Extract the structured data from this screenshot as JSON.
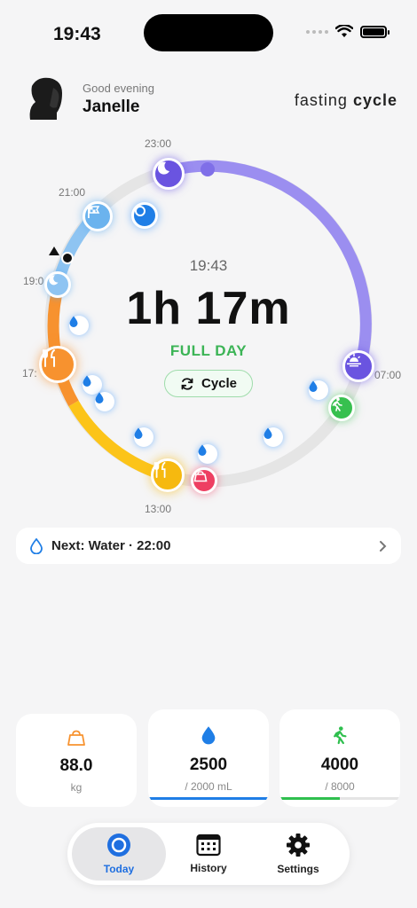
{
  "status_bar": {
    "time": "19:43"
  },
  "header": {
    "greeting": "Good evening",
    "name": "Janelle",
    "logo_prefix": "fasting",
    "logo_suffix": "cycle"
  },
  "dial": {
    "current_time": "19:43",
    "elapsed": "1h 17m",
    "phase": "FULL DAY",
    "cycle_button": "Cycle",
    "hour_labels": {
      "h23": "23:00",
      "h21": "21:00",
      "h19": "19:0",
      "h17": "17:",
      "h13": "13:00",
      "h07": "07:00"
    },
    "colors": {
      "night": "#9b8ef0",
      "evening": "#8ec4f2",
      "orange": "#f7922f",
      "yellow": "#fcc419",
      "track": "#e3e3e3"
    }
  },
  "next": {
    "label": "Next: Water · 22:00"
  },
  "stats": {
    "weight": {
      "value": "88.0",
      "unit": "kg"
    },
    "water": {
      "value": "2500",
      "unit": "/ 2000 mL",
      "progress": 1.0,
      "color": "#1f7ee6"
    },
    "steps": {
      "value": "4000",
      "unit": "/ 8000",
      "progress": 0.5,
      "color": "#2fbf4e"
    }
  },
  "tabs": {
    "today": "Today",
    "history": "History",
    "settings": "Settings"
  }
}
